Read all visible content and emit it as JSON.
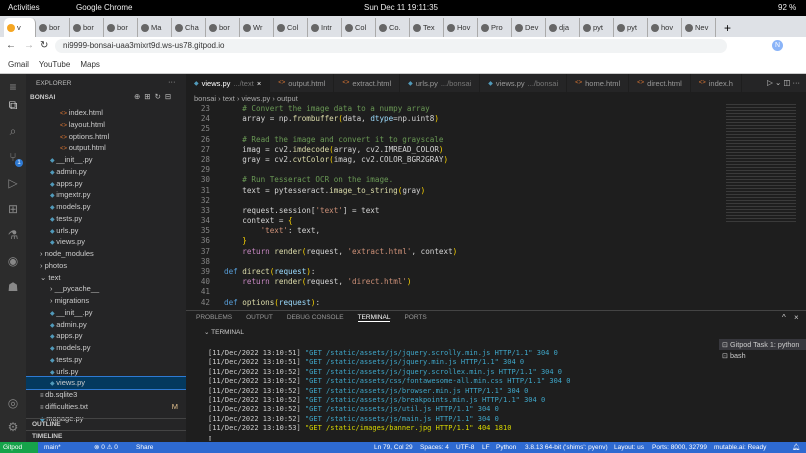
{
  "os_bar": {
    "activities": "Activities",
    "app": "Google Chrome",
    "clock": "Sun Dec 11  19:11:35",
    "battery": "92 %"
  },
  "browser": {
    "tabs": [
      "v",
      "bor",
      "bor",
      "bor",
      "Ma",
      "Cha",
      "bor",
      "Wr",
      "Col",
      "Intr",
      "Col",
      "Co.",
      "Tex",
      "Hov",
      "Pro",
      "Dev",
      "dja",
      "pyt",
      "pyt",
      "hov",
      "Nev"
    ],
    "url": "ni9999-bonsai-uaa3mixrt9d.ws-us78.gitpod.io",
    "bookmarks": [
      "Gmail",
      "YouTube",
      "Maps"
    ],
    "avatar": "N"
  },
  "sidebar": {
    "title": "EXPLORER",
    "root": "BONSAI",
    "items": [
      {
        "label": "index.html",
        "type": "ht",
        "indent": 3
      },
      {
        "label": "layout.html",
        "type": "ht",
        "indent": 3
      },
      {
        "label": "options.html",
        "type": "ht",
        "indent": 3
      },
      {
        "label": "output.html",
        "type": "ht",
        "indent": 3
      },
      {
        "label": "__init__.py",
        "type": "py",
        "indent": 2
      },
      {
        "label": "admin.py",
        "type": "py",
        "indent": 2
      },
      {
        "label": "apps.py",
        "type": "py",
        "indent": 2
      },
      {
        "label": "imgextr.py",
        "type": "py",
        "indent": 2
      },
      {
        "label": "models.py",
        "type": "py",
        "indent": 2
      },
      {
        "label": "tests.py",
        "type": "py",
        "indent": 2
      },
      {
        "label": "urls.py",
        "type": "py",
        "indent": 2
      },
      {
        "label": "views.py",
        "type": "py",
        "indent": 2
      },
      {
        "label": "› node_modules",
        "type": "dir",
        "indent": 1
      },
      {
        "label": "› photos",
        "type": "dir",
        "indent": 1
      },
      {
        "label": "⌄ text",
        "type": "dir",
        "indent": 1
      },
      {
        "label": "› __pycache__",
        "type": "dir",
        "indent": 2
      },
      {
        "label": "› migrations",
        "type": "dir",
        "indent": 2
      },
      {
        "label": "__init__.py",
        "type": "py",
        "indent": 2
      },
      {
        "label": "admin.py",
        "type": "py",
        "indent": 2
      },
      {
        "label": "apps.py",
        "type": "py",
        "indent": 2
      },
      {
        "label": "models.py",
        "type": "py",
        "indent": 2
      },
      {
        "label": "tests.py",
        "type": "py",
        "indent": 2
      },
      {
        "label": "urls.py",
        "type": "py",
        "indent": 2
      },
      {
        "label": "views.py",
        "type": "py",
        "indent": 2,
        "selected": true
      },
      {
        "label": "db.sqlite3",
        "type": "f",
        "indent": 1
      },
      {
        "label": "difficulties.txt",
        "type": "f",
        "indent": 1,
        "badge": "M"
      },
      {
        "label": "manage.py",
        "type": "py",
        "indent": 1
      }
    ],
    "outline": "OUTLINE",
    "timeline": "TIMELINE",
    "scm_badge": "1",
    "accounts_badge": "1"
  },
  "editor": {
    "tabs": [
      {
        "label": "views.py",
        "hint": ".../text",
        "type": "py",
        "active": true
      },
      {
        "label": "output.html",
        "type": "ht"
      },
      {
        "label": "extract.html",
        "type": "ht"
      },
      {
        "label": "urls.py",
        "hint": ".../bonsai",
        "type": "py"
      },
      {
        "label": "views.py",
        "hint": ".../bonsai",
        "type": "py"
      },
      {
        "label": "home.html",
        "type": "ht"
      },
      {
        "label": "direct.html",
        "type": "ht"
      },
      {
        "label": "index.h",
        "type": "ht"
      }
    ],
    "breadcrumb": "bonsai › text › views.py › output",
    "lines": [
      [
        23,
        [
          [
            "    # Convert the image data to a numpy array",
            "cm"
          ]
        ]
      ],
      [
        24,
        [
          [
            "    array = np.",
            "tx"
          ],
          [
            "frombuffer",
            "fn"
          ],
          [
            "(",
            "br"
          ],
          [
            "data, ",
            "tx"
          ],
          [
            "dtype",
            "vr"
          ],
          [
            "=np.uint8",
            "tx"
          ],
          [
            ")",
            "br"
          ]
        ]
      ],
      [
        25,
        []
      ],
      [
        26,
        [
          [
            "    # Read the image and convert it to grayscale",
            "cm"
          ]
        ]
      ],
      [
        27,
        [
          [
            "    imag = cv2.",
            "tx"
          ],
          [
            "imdecode",
            "fn"
          ],
          [
            "(",
            "br"
          ],
          [
            "array, cv2.IMREAD_COLOR",
            "tx"
          ],
          [
            ")",
            "br"
          ]
        ]
      ],
      [
        28,
        [
          [
            "    gray = cv2.",
            "tx"
          ],
          [
            "cvtColor",
            "fn"
          ],
          [
            "(",
            "br"
          ],
          [
            "imag, cv2.COLOR_BGR2GRAY",
            "tx"
          ],
          [
            ")",
            "br"
          ]
        ]
      ],
      [
        29,
        []
      ],
      [
        30,
        [
          [
            "    # Run Tesseract OCR on the image.",
            "cm"
          ]
        ]
      ],
      [
        31,
        [
          [
            "    text = pytesseract.",
            "tx"
          ],
          [
            "image_to_string",
            "fn"
          ],
          [
            "(",
            "br"
          ],
          [
            "gray",
            "tx"
          ],
          [
            ")",
            "br"
          ]
        ]
      ],
      [
        32,
        []
      ],
      [
        33,
        [
          [
            "    request.session[",
            "tx"
          ],
          [
            "'text'",
            "st"
          ],
          [
            "] = text",
            "tx"
          ]
        ]
      ],
      [
        34,
        [
          [
            "    context = ",
            "tx"
          ],
          [
            "{",
            "br"
          ]
        ]
      ],
      [
        35,
        [
          [
            "        ",
            "tx"
          ],
          [
            "'text'",
            "st"
          ],
          [
            ": text,",
            "tx"
          ]
        ]
      ],
      [
        36,
        [
          [
            "    ",
            "tx"
          ],
          [
            "}",
            "br"
          ]
        ]
      ],
      [
        37,
        [
          [
            "    ",
            "tx"
          ],
          [
            "return",
            "kw"
          ],
          [
            " render",
            "fn"
          ],
          [
            "(",
            "br"
          ],
          [
            "request, ",
            "tx"
          ],
          [
            "'extract.html'",
            "st"
          ],
          [
            ", context",
            "tx"
          ],
          [
            ")",
            "br"
          ]
        ]
      ],
      [
        38,
        []
      ],
      [
        39,
        [
          [
            "def",
            "df"
          ],
          [
            " direct",
            "fn"
          ],
          [
            "(",
            "br"
          ],
          [
            "request",
            "vr"
          ],
          [
            ")",
            "br"
          ],
          [
            ":",
            "tx"
          ]
        ]
      ],
      [
        40,
        [
          [
            "    ",
            "tx"
          ],
          [
            "return",
            "kw"
          ],
          [
            " render",
            "fn"
          ],
          [
            "(",
            "br"
          ],
          [
            "request, ",
            "tx"
          ],
          [
            "'direct.html'",
            "st"
          ],
          [
            ")",
            "br"
          ]
        ]
      ],
      [
        41,
        []
      ],
      [
        42,
        [
          [
            "def",
            "df"
          ],
          [
            " options",
            "fn"
          ],
          [
            "(",
            "br"
          ],
          [
            "request",
            "vr"
          ],
          [
            ")",
            "br"
          ],
          [
            ":",
            "tx"
          ]
        ]
      ]
    ]
  },
  "panel": {
    "tabs": [
      "PROBLEMS",
      "OUTPUT",
      "DEBUG CONSOLE",
      "TERMINAL",
      "PORTS"
    ],
    "active": "TERMINAL",
    "section": "TERMINAL",
    "lines": [
      [
        "[11/Dec/2022 13:10:51] ",
        "\"GET /static/assets/js/jquery.scrolly.min.js HTTP/1.1\" 304 0"
      ],
      [
        "[11/Dec/2022 13:10:51] ",
        "\"GET /static/assets/js/jquery.min.js HTTP/1.1\" 304 0"
      ],
      [
        "[11/Dec/2022 13:10:52] ",
        "\"GET /static/assets/js/jquery.scrollex.min.js HTTP/1.1\" 304 0"
      ],
      [
        "[11/Dec/2022 13:10:52] ",
        "\"GET /static/assets/css/fontawesome-all.min.css HTTP/1.1\" 304 0"
      ],
      [
        "[11/Dec/2022 13:10:52] ",
        "\"GET /static/assets/js/browser.min.js HTTP/1.1\" 304 0"
      ],
      [
        "[11/Dec/2022 13:10:52] ",
        "\"GET /static/assets/js/breakpoints.min.js HTTP/1.1\" 304 0"
      ],
      [
        "[11/Dec/2022 13:10:52] ",
        "\"GET /static/assets/js/util.js HTTP/1.1\" 304 0"
      ],
      [
        "[11/Dec/2022 13:10:52] ",
        "\"GET /static/assets/js/main.js HTTP/1.1\" 304 0"
      ],
      [
        "[11/Dec/2022 13:10:53] ",
        "\"GET /static/images/banner.jpg HTTP/1.1\" 404 1810"
      ]
    ],
    "terminals": [
      "Gitpod Task 1: python",
      "bash"
    ]
  },
  "status": {
    "gitpod": "Gitpod",
    "branch": "main*",
    "problems": "⊗ 0 ⚠ 0",
    "share": "Share",
    "position": "Ln 79, Col 29",
    "spaces": "Spaces: 4",
    "encoding": "UTF-8",
    "eol": "LF",
    "language": "Python",
    "interpreter": "3.8.13 64-bit ('shims': pyenv)",
    "layout": "Layout: us",
    "ports": "Ports: 8000, 32799",
    "mutable": "mutable.ai: Ready"
  }
}
